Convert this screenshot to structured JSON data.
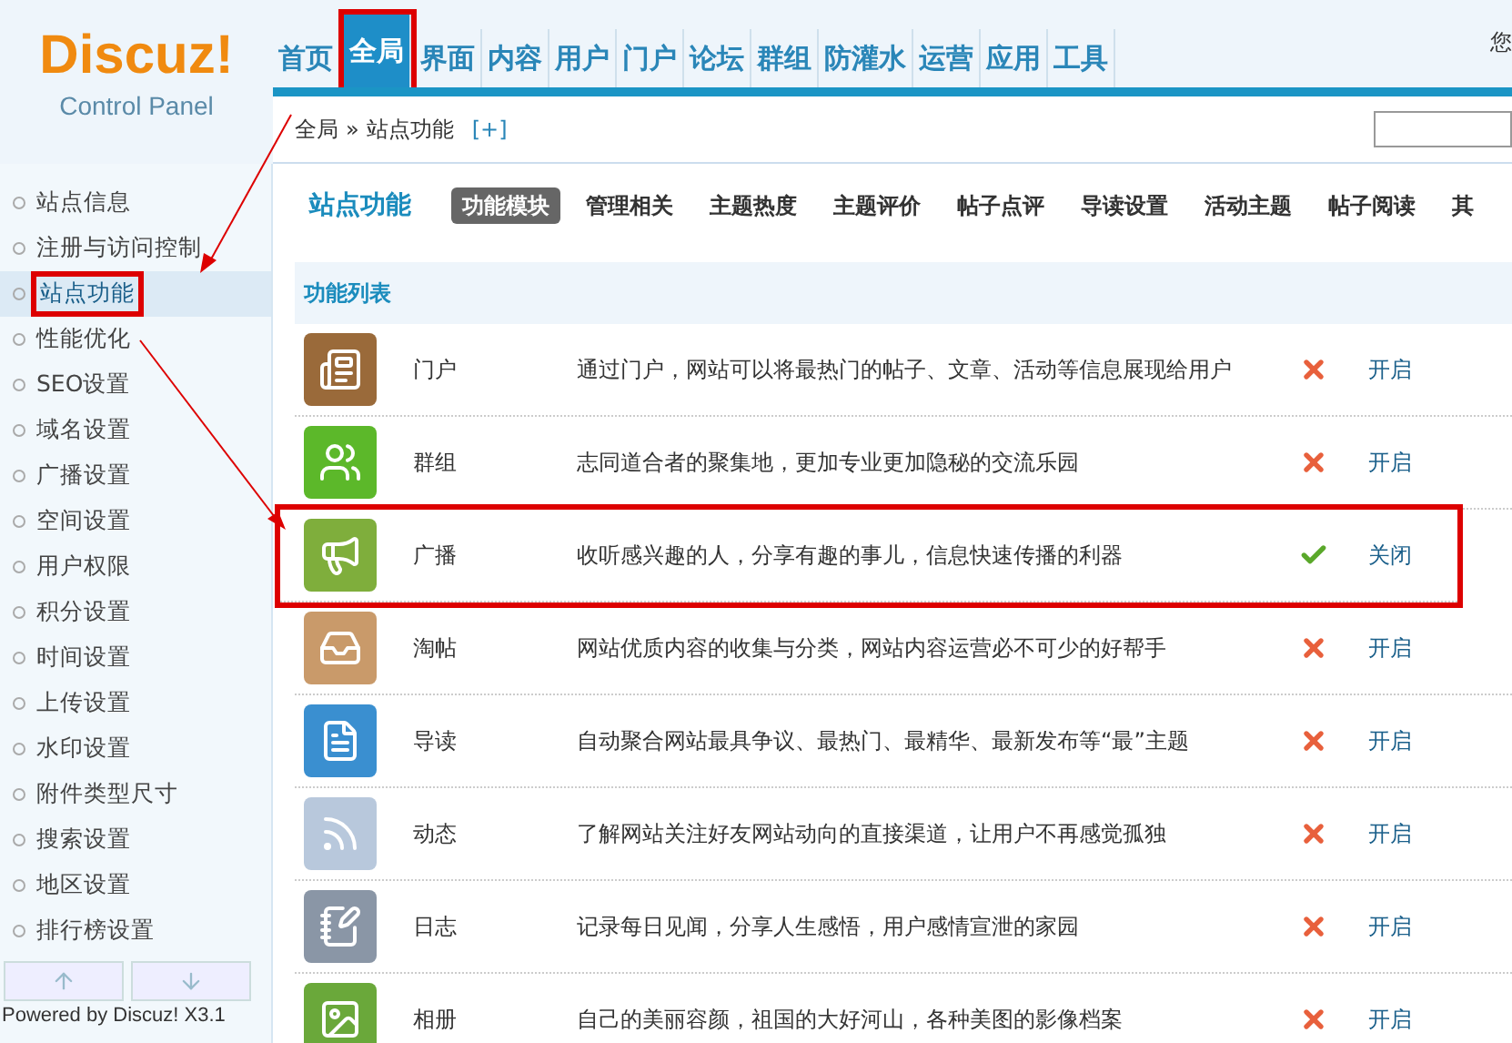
{
  "logo": {
    "title": "Discuz!",
    "subtitle": "Control Panel"
  },
  "nav": [
    {
      "label": "首页",
      "selected": false
    },
    {
      "label": "全局",
      "selected": true
    },
    {
      "label": "界面",
      "selected": false
    },
    {
      "label": "内容",
      "selected": false
    },
    {
      "label": "用户",
      "selected": false
    },
    {
      "label": "门户",
      "selected": false
    },
    {
      "label": "论坛",
      "selected": false
    },
    {
      "label": "群组",
      "selected": false
    },
    {
      "label": "防灌水",
      "selected": false
    },
    {
      "label": "运营",
      "selected": false
    },
    {
      "label": "应用",
      "selected": false
    },
    {
      "label": "工具",
      "selected": false
    }
  ],
  "greeting": "您",
  "breadcrumb": {
    "parent": "全局",
    "separator": "»",
    "current": "站点功能",
    "add": "[+]"
  },
  "sidebar": {
    "items": [
      {
        "label": "站点信息",
        "selected": false
      },
      {
        "label": "注册与访问控制",
        "selected": false
      },
      {
        "label": "站点功能",
        "selected": true
      },
      {
        "label": "性能优化",
        "selected": false
      },
      {
        "label": "SEO设置",
        "selected": false
      },
      {
        "label": "域名设置",
        "selected": false
      },
      {
        "label": "广播设置",
        "selected": false
      },
      {
        "label": "空间设置",
        "selected": false
      },
      {
        "label": "用户权限",
        "selected": false
      },
      {
        "label": "积分设置",
        "selected": false
      },
      {
        "label": "时间设置",
        "selected": false
      },
      {
        "label": "上传设置",
        "selected": false
      },
      {
        "label": "水印设置",
        "selected": false
      },
      {
        "label": "附件类型尺寸",
        "selected": false
      },
      {
        "label": "搜索设置",
        "selected": false
      },
      {
        "label": "地区设置",
        "selected": false
      },
      {
        "label": "排行榜设置",
        "selected": false
      }
    ],
    "footer": "Powered by Discuz! X3.1"
  },
  "page_title": "站点功能",
  "subtabs": [
    {
      "label": "功能模块",
      "selected": true
    },
    {
      "label": "管理相关",
      "selected": false
    },
    {
      "label": "主题热度",
      "selected": false
    },
    {
      "label": "主题评价",
      "selected": false
    },
    {
      "label": "帖子点评",
      "selected": false
    },
    {
      "label": "导读设置",
      "selected": false
    },
    {
      "label": "活动主题",
      "selected": false
    },
    {
      "label": "帖子阅读",
      "selected": false
    },
    {
      "label": "其",
      "selected": false
    }
  ],
  "list_title": "功能列表",
  "features": [
    {
      "name": "门户",
      "description": "通过门户，网站可以将最热门的帖子、文章、活动等信息展现给用户",
      "enabled": false,
      "action": "开启",
      "highlighted": false
    },
    {
      "name": "群组",
      "description": "志同道合者的聚集地，更加专业更加隐秘的交流乐园",
      "enabled": false,
      "action": "开启",
      "highlighted": false
    },
    {
      "name": "广播",
      "description": "收听感兴趣的人，分享有趣的事儿，信息快速传播的利器",
      "enabled": true,
      "action": "关闭",
      "highlighted": true
    },
    {
      "name": "淘帖",
      "description": "网站优质内容的收集与分类，网站内容运营必不可少的好帮手",
      "enabled": false,
      "action": "开启",
      "highlighted": false
    },
    {
      "name": "导读",
      "description": "自动聚合网站最具争议、最热门、最精华、最新发布等“最”主题",
      "enabled": false,
      "action": "开启",
      "highlighted": false
    },
    {
      "name": "动态",
      "description": "了解网站关注好友网站动向的直接渠道，让用户不再感觉孤独",
      "enabled": false,
      "action": "开启",
      "highlighted": false
    },
    {
      "name": "日志",
      "description": "记录每日见闻，分享人生感悟，用户感情宣泄的家园",
      "enabled": false,
      "action": "开启",
      "highlighted": false
    },
    {
      "name": "相册",
      "description": "自己的美丽容颜，祖国的大好河山，各种美图的影像档案",
      "enabled": false,
      "action": "开启",
      "highlighted": false
    }
  ]
}
